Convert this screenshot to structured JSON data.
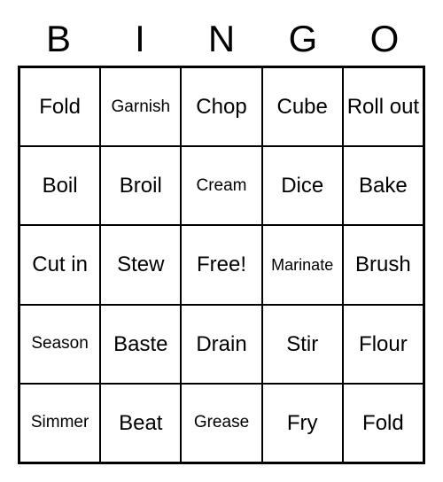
{
  "header": [
    "B",
    "I",
    "N",
    "G",
    "O"
  ],
  "grid": [
    [
      {
        "label": "Fold",
        "size": "normal"
      },
      {
        "label": "Garnish",
        "size": "small"
      },
      {
        "label": "Chop",
        "size": "normal"
      },
      {
        "label": "Cube",
        "size": "normal"
      },
      {
        "label": "Roll out",
        "size": "normal"
      }
    ],
    [
      {
        "label": "Boil",
        "size": "normal"
      },
      {
        "label": "Broil",
        "size": "normal"
      },
      {
        "label": "Cream",
        "size": "small"
      },
      {
        "label": "Dice",
        "size": "normal"
      },
      {
        "label": "Bake",
        "size": "normal"
      }
    ],
    [
      {
        "label": "Cut in",
        "size": "normal"
      },
      {
        "label": "Stew",
        "size": "normal"
      },
      {
        "label": "Free!",
        "size": "normal"
      },
      {
        "label": "Marinate",
        "size": "xsmall"
      },
      {
        "label": "Brush",
        "size": "normal"
      }
    ],
    [
      {
        "label": "Season",
        "size": "small"
      },
      {
        "label": "Baste",
        "size": "normal"
      },
      {
        "label": "Drain",
        "size": "normal"
      },
      {
        "label": "Stir",
        "size": "normal"
      },
      {
        "label": "Flour",
        "size": "normal"
      }
    ],
    [
      {
        "label": "Simmer",
        "size": "small"
      },
      {
        "label": "Beat",
        "size": "normal"
      },
      {
        "label": "Grease",
        "size": "small"
      },
      {
        "label": "Fry",
        "size": "normal"
      },
      {
        "label": "Fold",
        "size": "normal"
      }
    ]
  ]
}
